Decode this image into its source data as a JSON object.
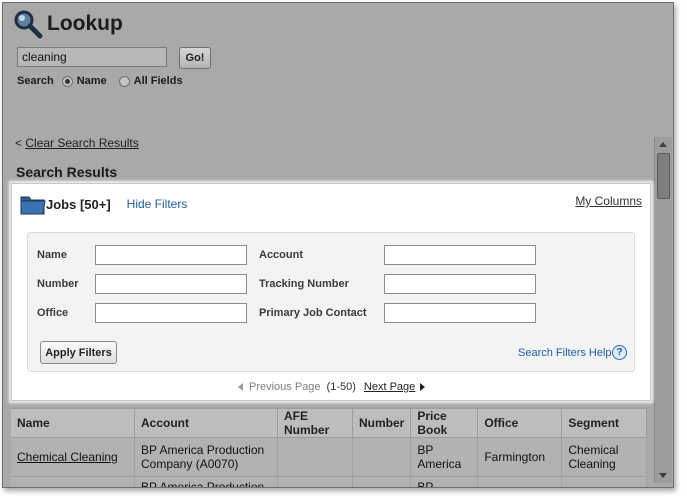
{
  "header": {
    "title": "Lookup",
    "icon": "magnifier-icon"
  },
  "search": {
    "value": "cleaning",
    "go_label": "Go!",
    "search_label": "Search",
    "options": [
      {
        "label": "Name",
        "selected": true
      },
      {
        "label": "All Fields",
        "selected": false
      }
    ]
  },
  "clear": {
    "prefix": "<",
    "label": "Clear Search Results"
  },
  "results": {
    "heading": "Search Results"
  },
  "panel": {
    "title": "Jobs [50+]",
    "hide_filters": "Hide Filters",
    "my_columns": "My Columns",
    "filters": {
      "name": "Name",
      "number": "Number",
      "office": "Office",
      "account": "Account",
      "tracking_number": "Tracking Number",
      "primary_job_contact": "Primary Job Contact"
    },
    "apply_label": "Apply Filters",
    "help_label": "Search Filters Help",
    "help_icon": "?"
  },
  "pager": {
    "previous": "Previous Page",
    "count": "(1-50)",
    "next": "Next Page"
  },
  "table": {
    "columns": [
      "Name",
      "Account",
      "AFE Number",
      "Number",
      "Price Book",
      "Office",
      "Segment"
    ],
    "rows": [
      {
        "name": "Chemical Cleaning",
        "account": "BP America Production Company (A0070)",
        "afe_number": "",
        "number": "",
        "price_book": "BP America",
        "office": "Farmington",
        "segment": "Chemical Cleaning"
      },
      {
        "name": "",
        "account": "BP America Production",
        "afe_number": "",
        "number": "",
        "price_book": "BP",
        "office": "",
        "segment": ""
      }
    ]
  },
  "colors": {
    "link": "#1a5fa8",
    "overlay": "#a9a9a9",
    "panel": "#ffffff"
  }
}
